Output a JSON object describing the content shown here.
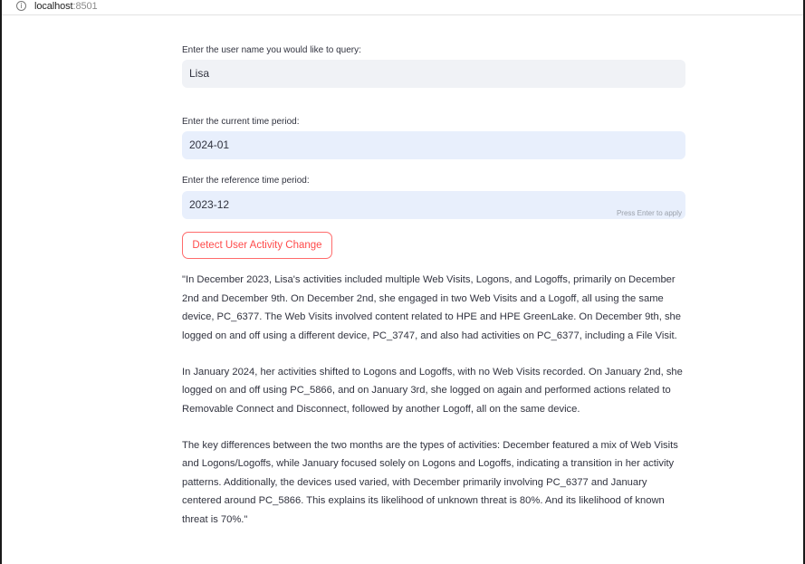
{
  "browser": {
    "host": "localhost",
    "port": ":8501",
    "info_glyph": "i"
  },
  "form": {
    "user": {
      "label": "Enter the user name you would like to query:",
      "value": "Lisa"
    },
    "current_period": {
      "label": "Enter the current time period:",
      "value": "2024-01"
    },
    "reference_period": {
      "label": "Enter the reference time period:",
      "value": "2023-12",
      "hint": "Press Enter to apply"
    },
    "detect_button_label": "Detect User Activity Change"
  },
  "result": {
    "paragraphs": [
      "\"In December 2023, Lisa's activities included multiple Web Visits, Logons, and Logoffs, primarily on December 2nd and December 9th. On December 2nd, she engaged in two Web Visits and a Logoff, all using the same device, PC_6377. The Web Visits involved content related to HPE and HPE GreenLake. On December 9th, she logged on and off using a different device, PC_3747, and also had activities on PC_6377, including a File Visit.",
      "In January 2024, her activities shifted to Logons and Logoffs, with no Web Visits recorded. On January 2nd, she logged on and off using PC_5866, and on January 3rd, she logged on again and performed actions related to Removable Connect and Disconnect, followed by another Logoff, all on the same device.",
      "The key differences between the two months are the types of activities: December featured a mix of Web Visits and Logons/Logoffs, while January focused solely on Logons and Logoffs, indicating a transition in her activity patterns. Additionally, the devices used varied, with December primarily involving PC_6377 and January centered around PC_5866. This explains its likelihood of unknown threat is 80%. And its likelihood of known threat is 70%.\""
    ]
  }
}
